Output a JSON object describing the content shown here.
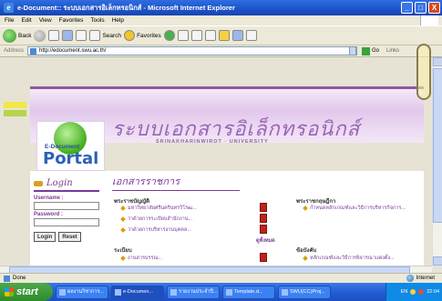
{
  "window": {
    "title": "e-Document:: ระบบเอกสารอิเล็กทรอนิกส์ - Microsoft Internet Explorer",
    "controls": [
      "_",
      "□",
      "X"
    ]
  },
  "menubar": {
    "items": [
      "File",
      "Edit",
      "View",
      "Favorites",
      "Tools",
      "Help"
    ]
  },
  "toolbar": {
    "back_label": "Back",
    "search_label": "Search",
    "favorites_label": "Favorites"
  },
  "addressbar": {
    "label": "Address",
    "url": "http://edocument.swu.ac.th/",
    "go_label": "Go",
    "links_label": "Links"
  },
  "banner": {
    "headline": "ระบบเอกสารอิเล็กทรอนิกส์",
    "subtitle": "SRINAKHARINWIROT · UNIVERSITY"
  },
  "logo": {
    "line1": "E-Document",
    "line2": "Portal"
  },
  "login": {
    "title": "Login",
    "username_label": "Username :",
    "password_label": "Password :",
    "login_button": "Login",
    "reset_button": "Reset"
  },
  "documents": {
    "title": "เอกสารราชการ",
    "sections": [
      {
        "title": "พระราชบัญญัติ",
        "items": [
          "มหาวิทยาลัยศรีนครินทรวิโรฒ...",
          "ว่าด้วยการระเบียบสำนักงาน...",
          "ว่าด้วยการบริหารงานบุคคล..."
        ]
      },
      {
        "title": "พระราชกฤษฎีกา",
        "items": [
          "กำหนดหลักเกณฑ์และวิธีการบริหารกิจการ..."
        ]
      },
      {
        "title": "ระเบียบ",
        "items": [
          "งานสารบรรณ..."
        ]
      },
      {
        "title": "ข้อบังคับ",
        "items": [
          "หลักเกณฑ์และวิธีการพิจารณาแต่งตั้ง..."
        ]
      }
    ],
    "all_news": "ดูทั้งหมด"
  },
  "statusbar": {
    "status": "Done",
    "zone": "Internet"
  },
  "taskbar": {
    "start": "start",
    "tasks": [
      "ผลงานวิชาการ...",
      "e-Documen...",
      "รายงานประจำปี...",
      "Template.d...",
      "SWU(CC)Proj..."
    ],
    "tray_lang": "EN",
    "tray_time": "22:04"
  },
  "colors": {
    "accent": "#7a3a9a",
    "banner_text": "#9a66b6",
    "xp_blue": "#245ed6"
  }
}
